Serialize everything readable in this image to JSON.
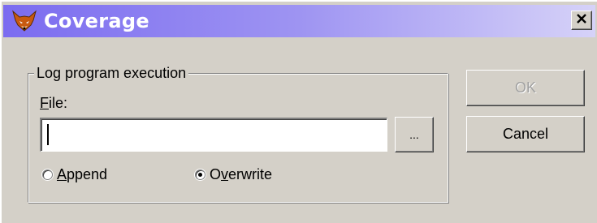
{
  "window": {
    "title": "Coverage",
    "close_label": "×"
  },
  "group": {
    "legend": "Log program execution"
  },
  "file": {
    "label_accel": "F",
    "label_rest": "ile:",
    "value": "",
    "placeholder": ""
  },
  "browse_button": {
    "label": "..."
  },
  "ok_button": {
    "label": "OK",
    "enabled": false
  },
  "cancel_button": {
    "label": "Cancel"
  },
  "mode": {
    "append": {
      "accel": "A",
      "rest": "ppend",
      "checked": false
    },
    "overwrite": {
      "pre": "O",
      "accel": "v",
      "rest": "erwrite",
      "checked": true
    }
  },
  "colors": {
    "titlebar_start": "#7b6cf0",
    "titlebar_end": "#d6d2f8",
    "face": "#d4d0c8"
  },
  "icons": {
    "app": "foxpro-fox-icon",
    "close": "close-icon"
  }
}
